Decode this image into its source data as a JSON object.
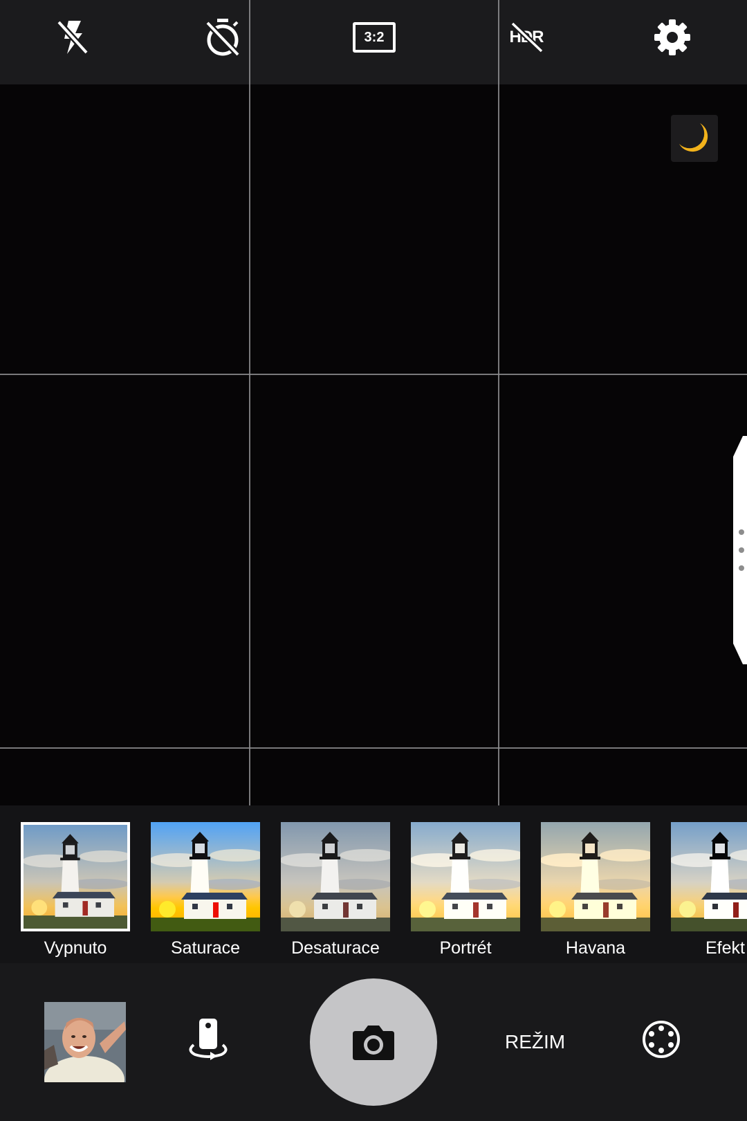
{
  "top_bar": {
    "flash_icon": "flash-off-icon",
    "timer_icon": "timer-off-icon",
    "aspect_ratio": "3:2",
    "hdr_label": "HDR",
    "settings_icon": "gear-icon"
  },
  "viewfinder": {
    "night_mode_icon": "moon-icon",
    "night_color": "#f2b21b"
  },
  "filters": [
    {
      "label": "Vypnuto",
      "selected": true
    },
    {
      "label": "Saturace",
      "selected": false
    },
    {
      "label": "Desaturace",
      "selected": false
    },
    {
      "label": "Portrét",
      "selected": false
    },
    {
      "label": "Havana",
      "selected": false
    },
    {
      "label": "Efekt",
      "selected": false
    }
  ],
  "bottom_bar": {
    "gallery_icon": "gallery-thumbnail",
    "switch_icon": "switch-camera-icon",
    "shutter_icon": "camera-icon",
    "mode_label": "REŽIM",
    "lens_icon": "aperture-icon"
  },
  "colors": {
    "top_bar_bg": "#1b1b1d",
    "viewfinder_bg": "#060506",
    "filter_bar_bg": "#141416",
    "bottom_bar_bg": "#19191b",
    "shutter_bg": "#c5c5c7"
  }
}
